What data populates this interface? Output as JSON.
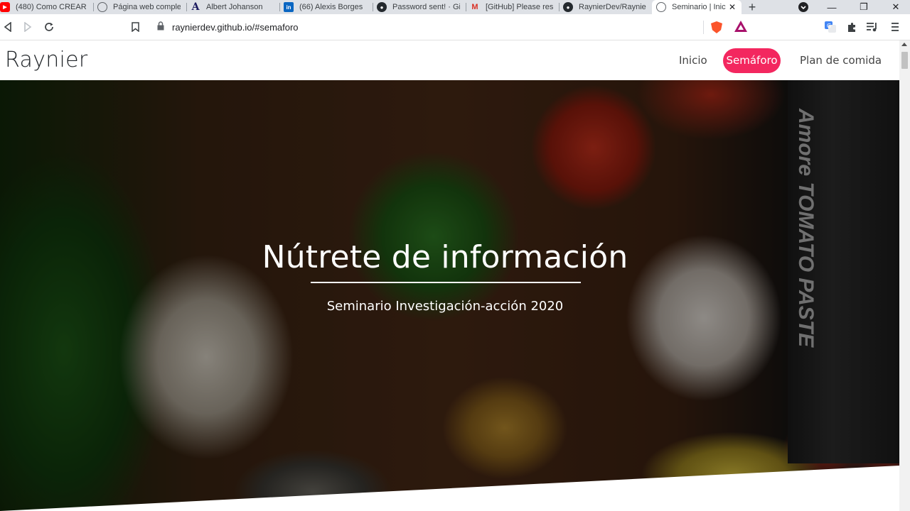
{
  "tabs": [
    {
      "title": "(480) Como CREAR",
      "icon": "youtube-icon"
    },
    {
      "title": "Página web comple",
      "icon": "globe-icon"
    },
    {
      "title": "Albert Johanson",
      "icon": "a-logo-icon"
    },
    {
      "title": "(66) Alexis Borges",
      "icon": "linkedin-icon"
    },
    {
      "title": "Password sent! · Gi",
      "icon": "github-icon"
    },
    {
      "title": "[GitHub] Please res",
      "icon": "gmail-icon"
    },
    {
      "title": "RaynierDev/Raynie",
      "icon": "github-icon"
    },
    {
      "title": "Seminario | Inic",
      "icon": "globe-icon",
      "active": true
    }
  ],
  "address_bar": {
    "url": "raynierdev.github.io/#semaforo"
  },
  "site": {
    "brand": "Raynier",
    "nav": [
      {
        "label": "Inicio",
        "active": false
      },
      {
        "label": "Semáforo",
        "active": true
      },
      {
        "label": "Plan de comida",
        "active": false
      }
    ],
    "accent_color": "#f3275f"
  },
  "hero": {
    "title": "Nútrete de información",
    "subtitle": "Seminario Investigación-acción 2020",
    "background_text": "Amore TOMATO PASTE"
  }
}
